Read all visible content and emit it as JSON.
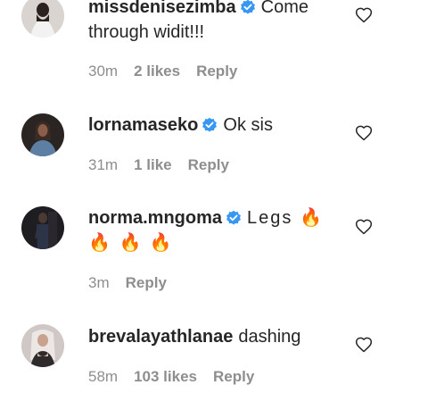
{
  "comments": [
    {
      "username": "missdenisezimba",
      "verified": true,
      "text": "Come through widit!!!",
      "time": "30m",
      "likes": "2 likes",
      "reply_label": "Reply",
      "avatar_icon": "avatar-photo",
      "like_icon": "heart-outline-icon"
    },
    {
      "username": "lornamaseko",
      "verified": true,
      "text": "Ok sis",
      "time": "31m",
      "likes": "1 like",
      "reply_label": "Reply",
      "avatar_icon": "avatar-photo",
      "like_icon": "heart-outline-icon"
    },
    {
      "username": "norma.mngoma",
      "verified": true,
      "text": "Legs 🔥 🔥 🔥 🔥",
      "time": "3m",
      "likes": "",
      "reply_label": "Reply",
      "avatar_icon": "avatar-photo",
      "like_icon": "heart-outline-icon"
    },
    {
      "username": "brevalayathlanae",
      "verified": false,
      "text": "dashing",
      "time": "58m",
      "likes": "103 likes",
      "reply_label": "Reply",
      "avatar_icon": "avatar-photo",
      "like_icon": "heart-outline-icon"
    }
  ],
  "colors": {
    "text": "#262626",
    "meta": "#8e8e8e",
    "verified_badge": "#3897f0",
    "background": "#ffffff"
  }
}
